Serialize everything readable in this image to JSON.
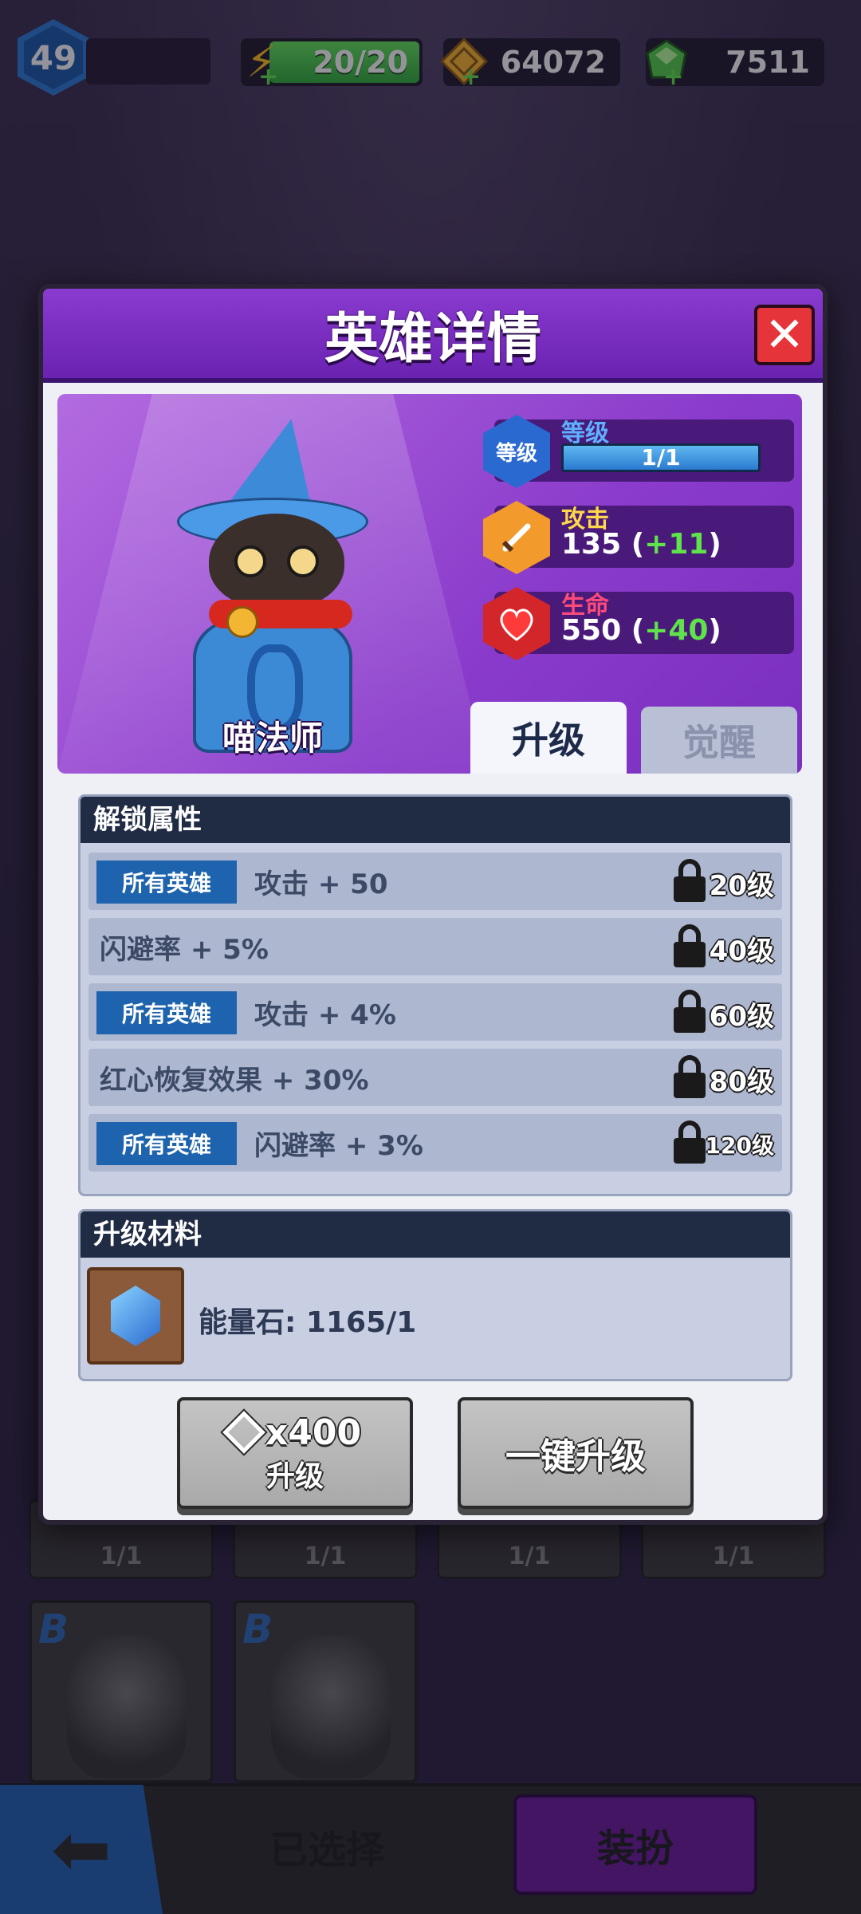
{
  "hud": {
    "player_level": "49",
    "energy": "20/20",
    "coins": "64072",
    "gems": "7511",
    "icons": {
      "energy": "lightning-icon",
      "coins": "gold-coin-icon",
      "gems": "green-gem-icon",
      "plus": "plus-icon"
    }
  },
  "dialog": {
    "title": "英雄详情",
    "close_icon": "close-icon",
    "hero": {
      "name": "喵法师",
      "level_label": "等级",
      "level_badge": "等级",
      "level_value": "1/1",
      "attack_label": "攻击",
      "attack_value": "135",
      "attack_bonus": "+11",
      "hp_label": "生命",
      "hp_value": "550",
      "hp_bonus": "+40"
    },
    "tabs": {
      "upgrade": "升级",
      "awaken": "觉醒"
    },
    "unlock": {
      "title": "解锁属性",
      "rows": [
        {
          "tag": "所有英雄",
          "text": "攻击 + 50",
          "level": "20级"
        },
        {
          "tag": "",
          "text": "闪避率 + 5%",
          "level": "40级"
        },
        {
          "tag": "所有英雄",
          "text": "攻击 + 4%",
          "level": "60级"
        },
        {
          "tag": "",
          "text": "红心恢复效果 + 30%",
          "level": "80级"
        },
        {
          "tag": "所有英雄",
          "text": "闪避率 + 3%",
          "level": "120级"
        }
      ]
    },
    "materials": {
      "title": "升级材料",
      "item": "能量石: 1165/1"
    },
    "buttons": {
      "upgrade_cost": "x400",
      "upgrade_label": "升级",
      "one_click": "一键升级"
    }
  },
  "background": {
    "slot_levels": [
      "1/1",
      "1/1",
      "1/1",
      "1/1"
    ],
    "card_badges": [
      "B",
      "B"
    ]
  },
  "bottom": {
    "selected": "已选择",
    "dress_up": "装扮"
  },
  "colors": {
    "header_purple": "#7a2fc0",
    "tag_blue": "#1d63ad",
    "bonus_green": "#5fe34b",
    "close_red": "#e5343a"
  }
}
